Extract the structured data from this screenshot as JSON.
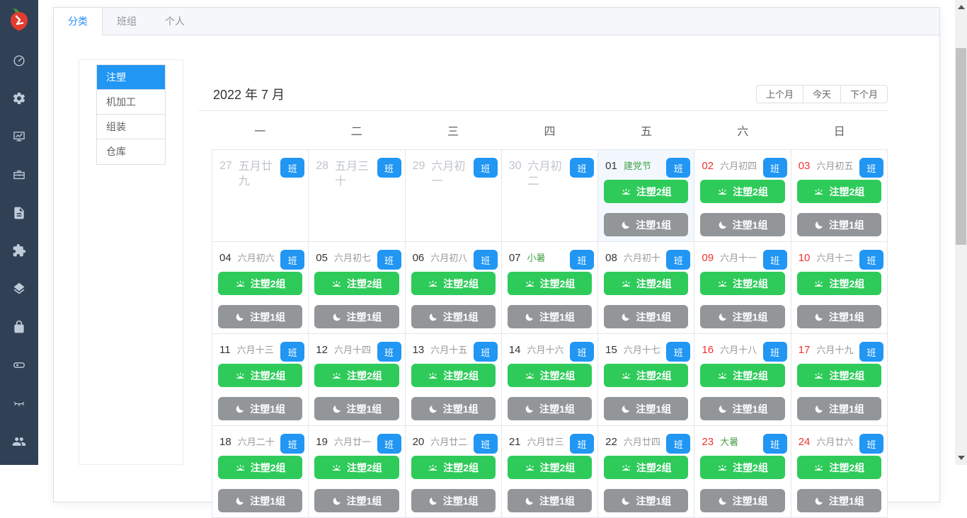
{
  "sidebar": {
    "logo_name": "app-logo",
    "icons": [
      "dashboard-icon",
      "settings-gear-icon",
      "monitor-chart-icon",
      "briefcase-icon",
      "document-icon",
      "component-puzzle-icon",
      "layers-icon",
      "lock-icon",
      "toggle-icon",
      "eye-closed-icon",
      "users-icon"
    ]
  },
  "tabs": [
    {
      "label": "分类",
      "active": true
    },
    {
      "label": "班组",
      "active": false
    },
    {
      "label": "个人",
      "active": false
    }
  ],
  "categories": [
    {
      "label": "注塑",
      "active": true
    },
    {
      "label": "机加工",
      "active": false
    },
    {
      "label": "组装",
      "active": false
    },
    {
      "label": "仓库",
      "active": false
    }
  ],
  "calendar": {
    "title": "2022 年 7 月",
    "controls": {
      "prev": "上个月",
      "today": "今天",
      "next": "下个月"
    },
    "day_headers": [
      "一",
      "二",
      "三",
      "四",
      "五",
      "六",
      "日"
    ],
    "badge_label": "班",
    "day_shift_label": "注塑2组",
    "night_shift_label": "注塑1组",
    "day_shift_icon": "sunrise-icon",
    "night_shift_icon": "moon-icon",
    "weeks": [
      [
        {
          "d": "27",
          "l": "五月廿九",
          "prev": true
        },
        {
          "d": "28",
          "l": "五月三十",
          "prev": true
        },
        {
          "d": "29",
          "l": "六月初一",
          "prev": true
        },
        {
          "d": "30",
          "l": "六月初二",
          "prev": true
        },
        {
          "d": "01",
          "l": "建党节",
          "fest": true,
          "today": true,
          "shifts": true
        },
        {
          "d": "02",
          "l": "六月初四",
          "red": true,
          "shifts": true
        },
        {
          "d": "03",
          "l": "六月初五",
          "red": true,
          "shifts": true
        }
      ],
      [
        {
          "d": "04",
          "l": "六月初六",
          "shifts": true
        },
        {
          "d": "05",
          "l": "六月初七",
          "shifts": true
        },
        {
          "d": "06",
          "l": "六月初八",
          "shifts": true
        },
        {
          "d": "07",
          "l": "小暑",
          "fest": true,
          "shifts": true
        },
        {
          "d": "08",
          "l": "六月初十",
          "shifts": true
        },
        {
          "d": "09",
          "l": "六月十一",
          "red": true,
          "shifts": true
        },
        {
          "d": "10",
          "l": "六月十二",
          "red": true,
          "shifts": true
        }
      ],
      [
        {
          "d": "11",
          "l": "六月十三",
          "shifts": true
        },
        {
          "d": "12",
          "l": "六月十四",
          "shifts": true
        },
        {
          "d": "13",
          "l": "六月十五",
          "shifts": true
        },
        {
          "d": "14",
          "l": "六月十六",
          "shifts": true
        },
        {
          "d": "15",
          "l": "六月十七",
          "shifts": true
        },
        {
          "d": "16",
          "l": "六月十八",
          "red": true,
          "shifts": true
        },
        {
          "d": "17",
          "l": "六月十九",
          "red": true,
          "shifts": true
        }
      ],
      [
        {
          "d": "18",
          "l": "六月二十",
          "shifts": true
        },
        {
          "d": "19",
          "l": "六月廿一",
          "shifts": true
        },
        {
          "d": "20",
          "l": "六月廿二",
          "shifts": true
        },
        {
          "d": "21",
          "l": "六月廿三",
          "shifts": true
        },
        {
          "d": "22",
          "l": "六月廿四",
          "shifts": true
        },
        {
          "d": "23",
          "l": "大暑",
          "red": true,
          "fest": true,
          "shifts": true
        },
        {
          "d": "24",
          "l": "六月廿六",
          "red": true,
          "shifts": true
        }
      ]
    ]
  },
  "colors": {
    "sidebar_bg": "#304156",
    "primary_blue": "#2196f3",
    "active_tab_blue": "#2a8ff7",
    "shift_day_green": "#2ecb5a",
    "shift_night_gray": "#939699",
    "weekend_red": "#f03232",
    "festival_green": "#43a047",
    "today_cell_bg": "#f2f8fe"
  }
}
